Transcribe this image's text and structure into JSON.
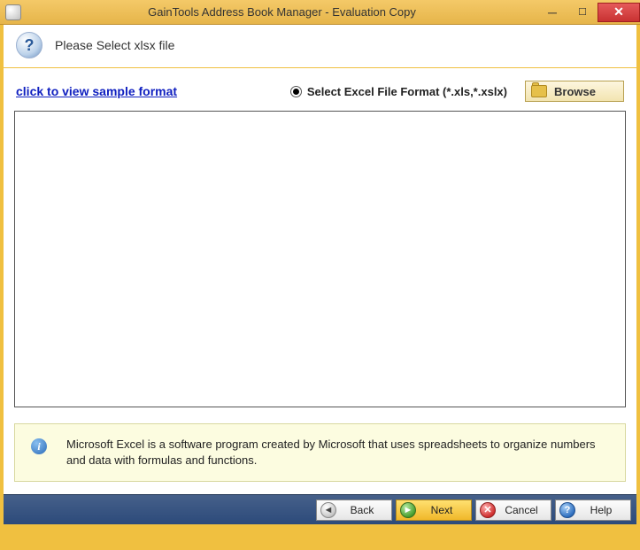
{
  "window": {
    "title": "GainTools Address Book Manager - Evaluation Copy"
  },
  "header": {
    "text": "Please Select xlsx file"
  },
  "links": {
    "sample": "click to view sample format"
  },
  "radio": {
    "excel_label": "Select Excel File Format (*.xls,*.xslx)"
  },
  "buttons": {
    "browse": "Browse",
    "back": "Back",
    "next": "Next",
    "cancel": "Cancel",
    "help": "Help"
  },
  "info": {
    "text": "Microsoft Excel is a software program created by Microsoft that uses spreadsheets to organize numbers and data with formulas and functions."
  }
}
